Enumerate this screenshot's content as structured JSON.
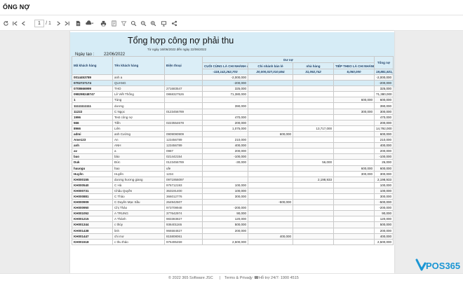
{
  "app": {
    "title": "ỔNG NỢ"
  },
  "toolbar": {
    "page_current": "1",
    "page_total": "/ 1"
  },
  "report": {
    "title": "Tổng hợp công nợ phải thu",
    "date_range": "Từ ngày 16/06/2022 đến ngày 22/06/2022",
    "created_label": "Ngày tạo :",
    "created_value": "22/06/2022"
  },
  "table": {
    "headers": {
      "code": "Mã khách hàng",
      "name": "Tên khách hàng",
      "phone": "Điện thoại",
      "debt_group": "Dư nợ",
      "total": "Tổng nợ",
      "branches": [
        "CUỐI CÙNG LÀ CHI NHÁNH 4",
        "Chi nhánh bán lẻ",
        "nhà hàng",
        "TIẾP THEO LÀ CHI NHÁNH 3"
      ]
    },
    "totals": [
      "-118,142,262,703",
      "20,000,027,010,554",
      "31,092,742",
      "6,050,000",
      "19,881,921,091,59"
    ],
    "rows": [
      [
        "0014453789",
        "anh a",
        "",
        "-2,000,000",
        "",
        "",
        "",
        "-2,000,000"
      ],
      [
        "0702727174",
        "QUANG",
        "",
        "-200,000",
        "",
        "",
        "",
        "-200,000"
      ],
      [
        "0708666999",
        "THO",
        "271683547",
        "325,000",
        "",
        "",
        "",
        "325,000"
      ],
      [
        "098298248747",
        "Lê Viết Thống",
        "0868327526",
        "71,380,000",
        "",
        "",
        "",
        "71,380,000"
      ],
      [
        "1",
        "Tùng",
        "",
        "",
        "",
        "",
        "600,000",
        "600,000"
      ],
      [
        "11111111111",
        "dương",
        "",
        "390,000",
        "",
        "",
        "",
        "390,000"
      ],
      [
        "11222",
        "C Ngọc",
        "0123456789",
        "",
        "",
        "",
        "300,000",
        "300,000"
      ],
      [
        "1996",
        "Test công nợ",
        "",
        "470,000",
        "",
        "",
        "",
        "470,000"
      ],
      [
        "566",
        "Tiến",
        "0223554678",
        "200,000",
        "",
        "",
        "",
        "200,000"
      ],
      [
        "8966",
        "Liên",
        "",
        "1,075,000",
        "",
        "13,717,000",
        "",
        "14,792,000"
      ],
      [
        "admi",
        "anh Cường",
        "0909090909",
        "",
        "600,000",
        "",
        "",
        "600,000"
      ],
      [
        "Ame123",
        "An",
        "123456789",
        "210,000",
        "",
        "",
        "",
        "210,000"
      ],
      [
        "anh",
        "ANH",
        "123456789",
        "400,000",
        "",
        "",
        "",
        "400,000"
      ],
      [
        "av",
        "a",
        "0987",
        "200,000",
        "",
        "",
        "",
        "200,000"
      ],
      [
        "bao",
        "bảo",
        "021442154",
        "-100,000",
        "",
        "",
        "",
        "-100,000"
      ],
      [
        "Duk",
        "Đức",
        "0123456789",
        "-30,000",
        "",
        "56,000",
        "",
        "26,000"
      ],
      [
        "hauogu",
        "hao",
        "ufe",
        "",
        "",
        "",
        "600,000",
        "600,000"
      ],
      [
        "Huyền",
        "Huyền",
        "1234",
        "",
        "",
        "",
        "300,000",
        "300,000"
      ],
      [
        "KH000155",
        "dương hương giang",
        "0971956097",
        "",
        "",
        "2,198,933",
        "",
        "2,198,933"
      ],
      [
        "KH000540",
        "C Hà",
        "976712193",
        "100,000",
        "",
        "",
        "",
        "100,000"
      ],
      [
        "KH000731",
        "Châu Quyền",
        "363191400",
        "100,000",
        "",
        "",
        "",
        "100,000"
      ],
      [
        "KH000881",
        "C Thảo",
        "366012776",
        "300,000",
        "",
        "",
        "",
        "300,000"
      ],
      [
        "KH000909",
        "C Duyên Mạc Sầu",
        "264942507",
        "",
        "-500,000",
        "",
        "",
        "-500,000"
      ],
      [
        "KH000950",
        "Chị Thảo",
        "973709948",
        "-200,000",
        "",
        "",
        "",
        "-200,000"
      ],
      [
        "KH001052",
        "A TRUNG",
        "377642974",
        "90,000",
        "",
        "",
        "",
        "90,000"
      ],
      [
        "KH001215",
        "A Thành",
        "983383827",
        "120,000",
        "",
        "",
        "",
        "120,000"
      ],
      [
        "KH001344",
        "c thủy",
        "936401165",
        "500,000",
        "",
        "",
        "",
        "500,000"
      ],
      [
        "KH001438",
        "linh",
        "966584827",
        "200,000",
        "",
        "",
        "",
        "200,000"
      ],
      [
        "KH001447",
        "chi mơ",
        "815808061",
        "",
        "400,000",
        "",
        "",
        "400,000"
      ],
      [
        "KH001518",
        "c thu thảo",
        "976495459",
        "2,500,000",
        "",
        "",
        "",
        "2,500,000"
      ]
    ]
  },
  "footer": {
    "copyright": "© 2022 365 Software JSC",
    "terms": "Terms & Privacy",
    "support": "Hỗ trợ 24/7: 1900 4515"
  },
  "logo": {
    "text": "POS365",
    "colors": {
      "accent": "#1a96d4",
      "dark": "#1f3f66"
    }
  }
}
